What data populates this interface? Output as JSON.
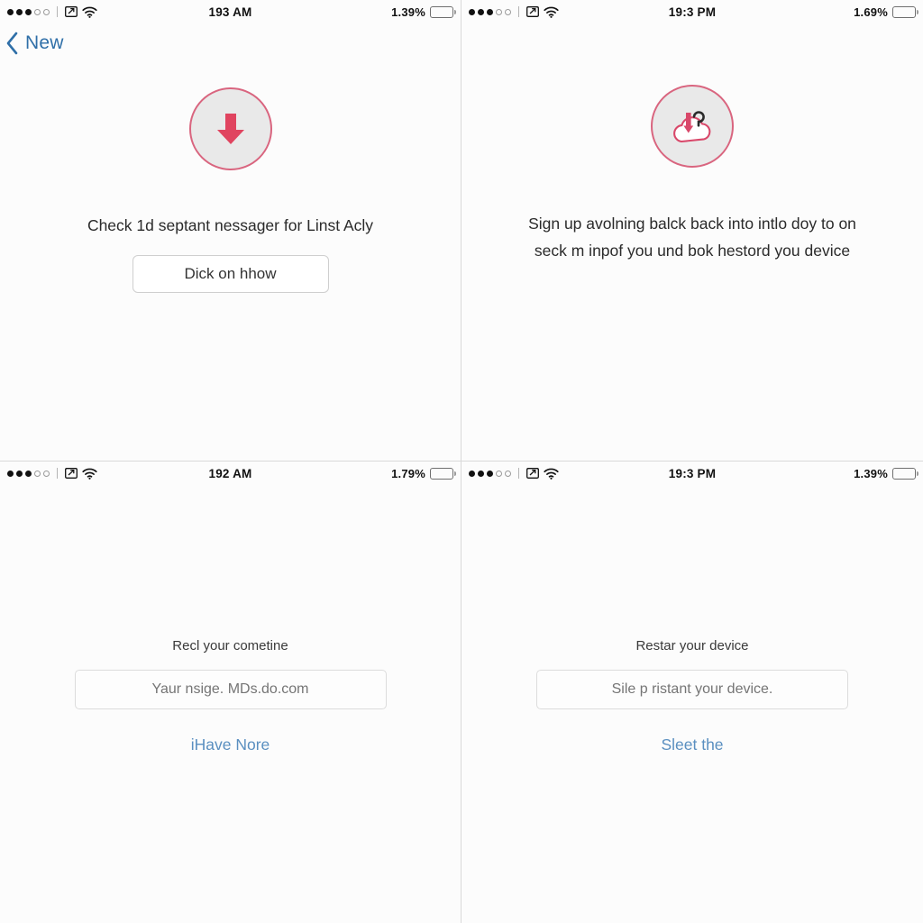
{
  "panes": [
    {
      "id": "pane-top-left",
      "status": {
        "signal_filled": 3,
        "signal_hollow": 2,
        "time": "193 AM",
        "battery_pct": "1.39%",
        "airplay_icon": "screen-share-icon",
        "wifi_icon": "wifi-icon",
        "battery_icon": "battery-icon"
      },
      "nav": {
        "has_nav": true,
        "back_icon": "chevron-left-icon",
        "back_label": "New"
      },
      "icon": {
        "name": "download-arrow-icon",
        "circle_fill": "#e9e9e9",
        "circle_border": "#d9657f",
        "glyph_color": "#e0445f"
      },
      "headline": "Check 1d septant nessager for Linst Acly",
      "button_label": "Dick on hhow"
    },
    {
      "id": "pane-top-right",
      "status": {
        "signal_filled": 3,
        "signal_hollow": 2,
        "time": "19:3 PM",
        "battery_pct": "1.69%",
        "airplay_icon": "screen-share-icon",
        "wifi_icon": "wifi-icon",
        "battery_icon": "battery-icon"
      },
      "nav": {
        "has_nav": false,
        "back_icon": "",
        "back_label": ""
      },
      "icon": {
        "name": "cloud-restore-question-icon",
        "circle_fill": "#e9e9e9",
        "circle_border": "#d9657f",
        "glyph_color": "#d9486a"
      },
      "headline": "Sign up avolning balck back into intlo doy to on seck m inpof you und bok hestord you device"
    },
    {
      "id": "pane-bottom-left",
      "status": {
        "signal_filled": 3,
        "signal_hollow": 2,
        "time": "192 AM",
        "battery_pct": "1.79%",
        "airplay_icon": "screen-share-icon",
        "wifi_icon": "wifi-icon",
        "battery_icon": "battery-icon"
      },
      "nav": {
        "has_nav": false,
        "back_icon": "",
        "back_label": ""
      },
      "field_label": "Recl your cometine",
      "field_placeholder": "Yaur nsige. MDs.do.com",
      "field_value": "",
      "link_label": "iHave Nore"
    },
    {
      "id": "pane-bottom-right",
      "status": {
        "signal_filled": 3,
        "signal_hollow": 2,
        "time": "19:3 PM",
        "battery_pct": "1.39%",
        "airplay_icon": "screen-share-icon",
        "wifi_icon": "wifi-icon",
        "battery_icon": "battery-icon"
      },
      "nav": {
        "has_nav": false,
        "back_icon": "",
        "back_label": ""
      },
      "field_label": "Restar your device",
      "field_placeholder": "Sile p ristant your device.",
      "field_value": "",
      "link_label": "Sleet the"
    }
  ],
  "theme": {
    "background": "#fcfcfc",
    "divider": "#d9d9d9",
    "accent_pink": "#e0445f",
    "accent_blue": "#5a8fc0",
    "nav_blue": "#2f6fa8",
    "text_primary": "#2b2b2b",
    "placeholder": "#b9b9b9"
  }
}
